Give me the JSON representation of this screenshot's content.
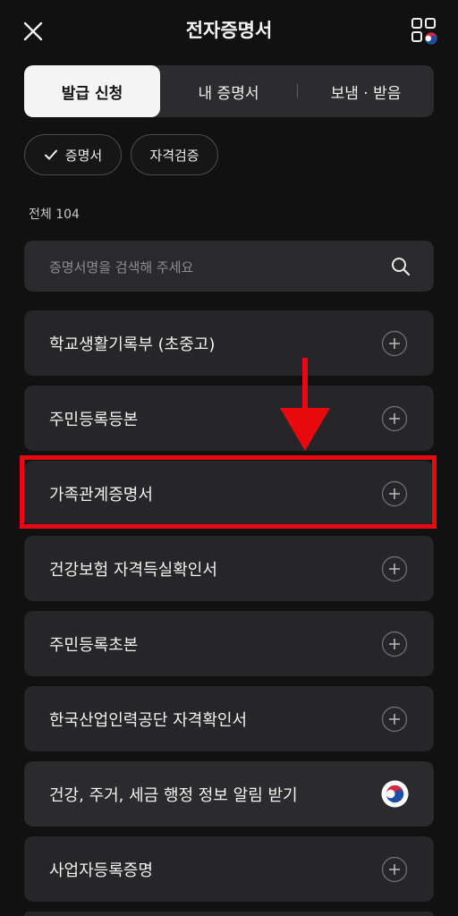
{
  "header": {
    "title": "전자증명서"
  },
  "tabs": [
    {
      "label": "발급 신청",
      "active": true
    },
    {
      "label": "내 증명서",
      "active": false
    },
    {
      "label": "보냄 · 받음",
      "active": false
    }
  ],
  "chips": [
    {
      "label": "증명서",
      "selected": true
    },
    {
      "label": "자격검증",
      "selected": false
    }
  ],
  "count_label": "전체 104",
  "search": {
    "placeholder": "증명서명을 검색해 주세요"
  },
  "items": [
    {
      "label": "학교생활기록부 (초중고)",
      "icon": "plus-circle-icon"
    },
    {
      "label": "주민등록등본",
      "icon": "plus-circle-icon"
    },
    {
      "label": "가족관계증명서",
      "icon": "plus-circle-icon"
    },
    {
      "label": "건강보험 자격득실확인서",
      "icon": "plus-circle-icon"
    },
    {
      "label": "주민등록초본",
      "icon": "plus-circle-icon"
    },
    {
      "label": "한국산업인력공단 자격확인서",
      "icon": "plus-circle-icon"
    },
    {
      "label": "건강, 주거, 세금 행정 정보 알림 받기",
      "icon": "korea-gov-emblem-icon"
    },
    {
      "label": "사업자등록증명",
      "icon": "plus-circle-icon"
    }
  ],
  "colors": {
    "background": "#111111",
    "card": "#262628",
    "highlight": "#e8090f",
    "active_tab": "#f4f4f4"
  }
}
